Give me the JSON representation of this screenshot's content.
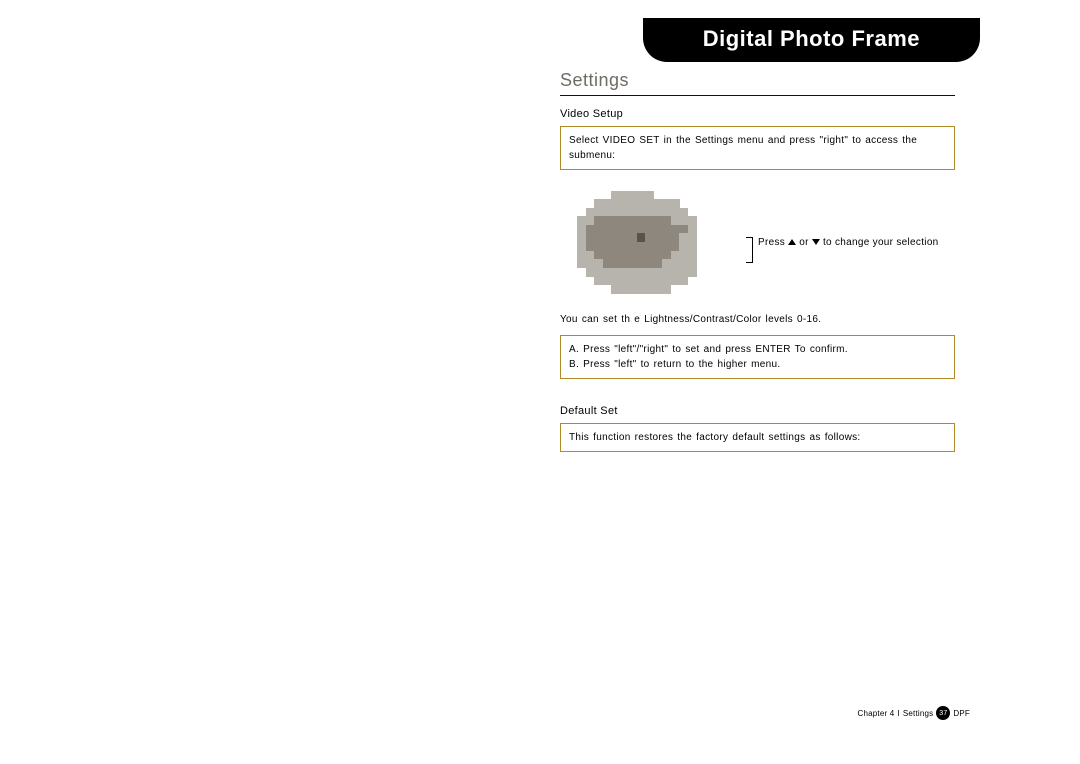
{
  "header": {
    "title": "Digital Photo Frame"
  },
  "settings": {
    "title": "Settings",
    "video_setup_head": "Video Setup",
    "video_setup_body": "Select VIDEO SET in the Settings menu and press \"right\" to access the submenu:",
    "callout_pre": "Press",
    "callout_mid": "or",
    "callout_post": "to change your selection",
    "levels_text": "You can set th e Lightness/Contrast/Color    levels 0-16.",
    "instructions_line_a": "A. Press \"left\"/\"right\" to set and press ENTER To confirm.",
    "instructions_line_b": "B. Press \"left\" to return to the higher menu.",
    "default_set_head": "Default Set",
    "default_set_body": "This function restores the factory default settings as follows:"
  },
  "footer": {
    "chapter": "Chapter 4",
    "sep": "I",
    "section": "Settings",
    "page": "37",
    "suffix": "DPF"
  },
  "pixel_grid": [
    "                    ",
    "      33333         ",
    "    3333333333      ",
    "   333333333333     ",
    "  33222222222333    ",
    "  32222222222223    ",
    "  32222221222233    ",
    "  32222222222233    ",
    "  33222222222333    ",
    "  33322222223333    ",
    "   3333333333333    ",
    "    33333333333     ",
    "      3333333       ",
    "                    "
  ],
  "pixel_colors": {
    " ": "transparent",
    "1": "#5b5346",
    "2": "#8e877e",
    "3": "#b7b3ad"
  }
}
